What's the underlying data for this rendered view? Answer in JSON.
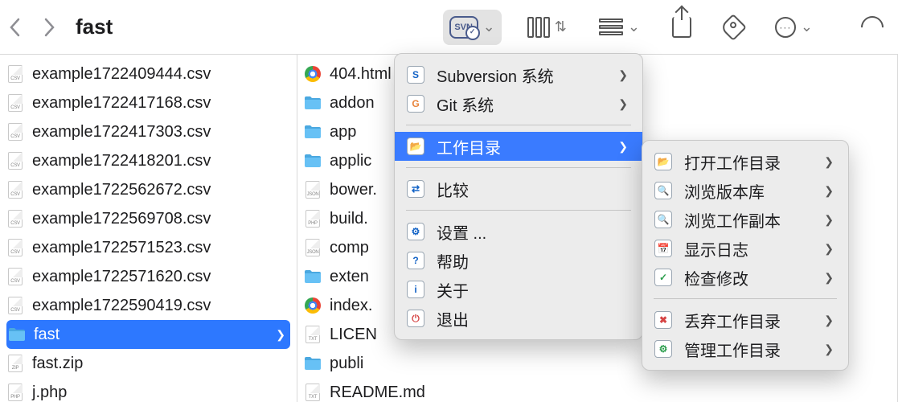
{
  "toolbar": {
    "path_title": "fast",
    "svn_label": "SVN"
  },
  "left_column": [
    {
      "name": "example1722409444.csv",
      "icon": "csv"
    },
    {
      "name": "example1722417168.csv",
      "icon": "csv"
    },
    {
      "name": "example1722417303.csv",
      "icon": "csv"
    },
    {
      "name": "example1722418201.csv",
      "icon": "csv"
    },
    {
      "name": "example1722562672.csv",
      "icon": "csv"
    },
    {
      "name": "example1722569708.csv",
      "icon": "csv"
    },
    {
      "name": "example1722571523.csv",
      "icon": "csv"
    },
    {
      "name": "example1722571620.csv",
      "icon": "csv"
    },
    {
      "name": "example1722590419.csv",
      "icon": "csv"
    },
    {
      "name": "fast",
      "icon": "folder",
      "selected": true,
      "has_children": true
    },
    {
      "name": "fast.zip",
      "icon": "zip"
    },
    {
      "name": "j.php",
      "icon": "php"
    }
  ],
  "right_column": [
    {
      "name": "404.html",
      "icon": "chrome"
    },
    {
      "name": "addons",
      "icon": "folder",
      "truncated": "addon"
    },
    {
      "name": "app",
      "icon": "folder"
    },
    {
      "name": "application",
      "icon": "folder",
      "truncated": "applic"
    },
    {
      "name": "bower.json",
      "icon": "json",
      "truncated": "bower."
    },
    {
      "name": "build.php",
      "icon": "php",
      "truncated": "build."
    },
    {
      "name": "composer.json",
      "icon": "json",
      "truncated": "comp"
    },
    {
      "name": "extend",
      "icon": "folder",
      "truncated": "exten"
    },
    {
      "name": "index.php",
      "icon": "chrome",
      "truncated": "index."
    },
    {
      "name": "LICENSE",
      "icon": "txt",
      "truncated": "LICEN"
    },
    {
      "name": "public",
      "icon": "folder",
      "truncated": "publi"
    },
    {
      "name": "README.md",
      "icon": "txt"
    }
  ],
  "menu_main": [
    {
      "label": "Subversion 系统",
      "icon": "svn",
      "arrow": true
    },
    {
      "label": "Git 系统",
      "icon": "git",
      "arrow": true
    },
    {
      "sep": true
    },
    {
      "label": "工作目录",
      "icon": "workdir",
      "arrow": true,
      "highlight": true
    },
    {
      "sep": true
    },
    {
      "label": "比较",
      "icon": "compare"
    },
    {
      "sep": true
    },
    {
      "label": "设置 ...",
      "icon": "settings"
    },
    {
      "label": "帮助",
      "icon": "help"
    },
    {
      "label": "关于",
      "icon": "about"
    },
    {
      "label": "退出",
      "icon": "quit"
    }
  ],
  "menu_sub": [
    {
      "label": "打开工作目录",
      "icon": "open",
      "arrow": true
    },
    {
      "label": "浏览版本库",
      "icon": "browse",
      "arrow": true
    },
    {
      "label": "浏览工作副本",
      "icon": "browsewc",
      "arrow": true
    },
    {
      "label": "显示日志",
      "icon": "log",
      "arrow": true
    },
    {
      "label": "检查修改",
      "icon": "check",
      "arrow": true
    },
    {
      "sep": true
    },
    {
      "label": "丢弃工作目录",
      "icon": "discard",
      "arrow": true
    },
    {
      "label": "管理工作目录",
      "icon": "manage",
      "arrow": true
    }
  ]
}
